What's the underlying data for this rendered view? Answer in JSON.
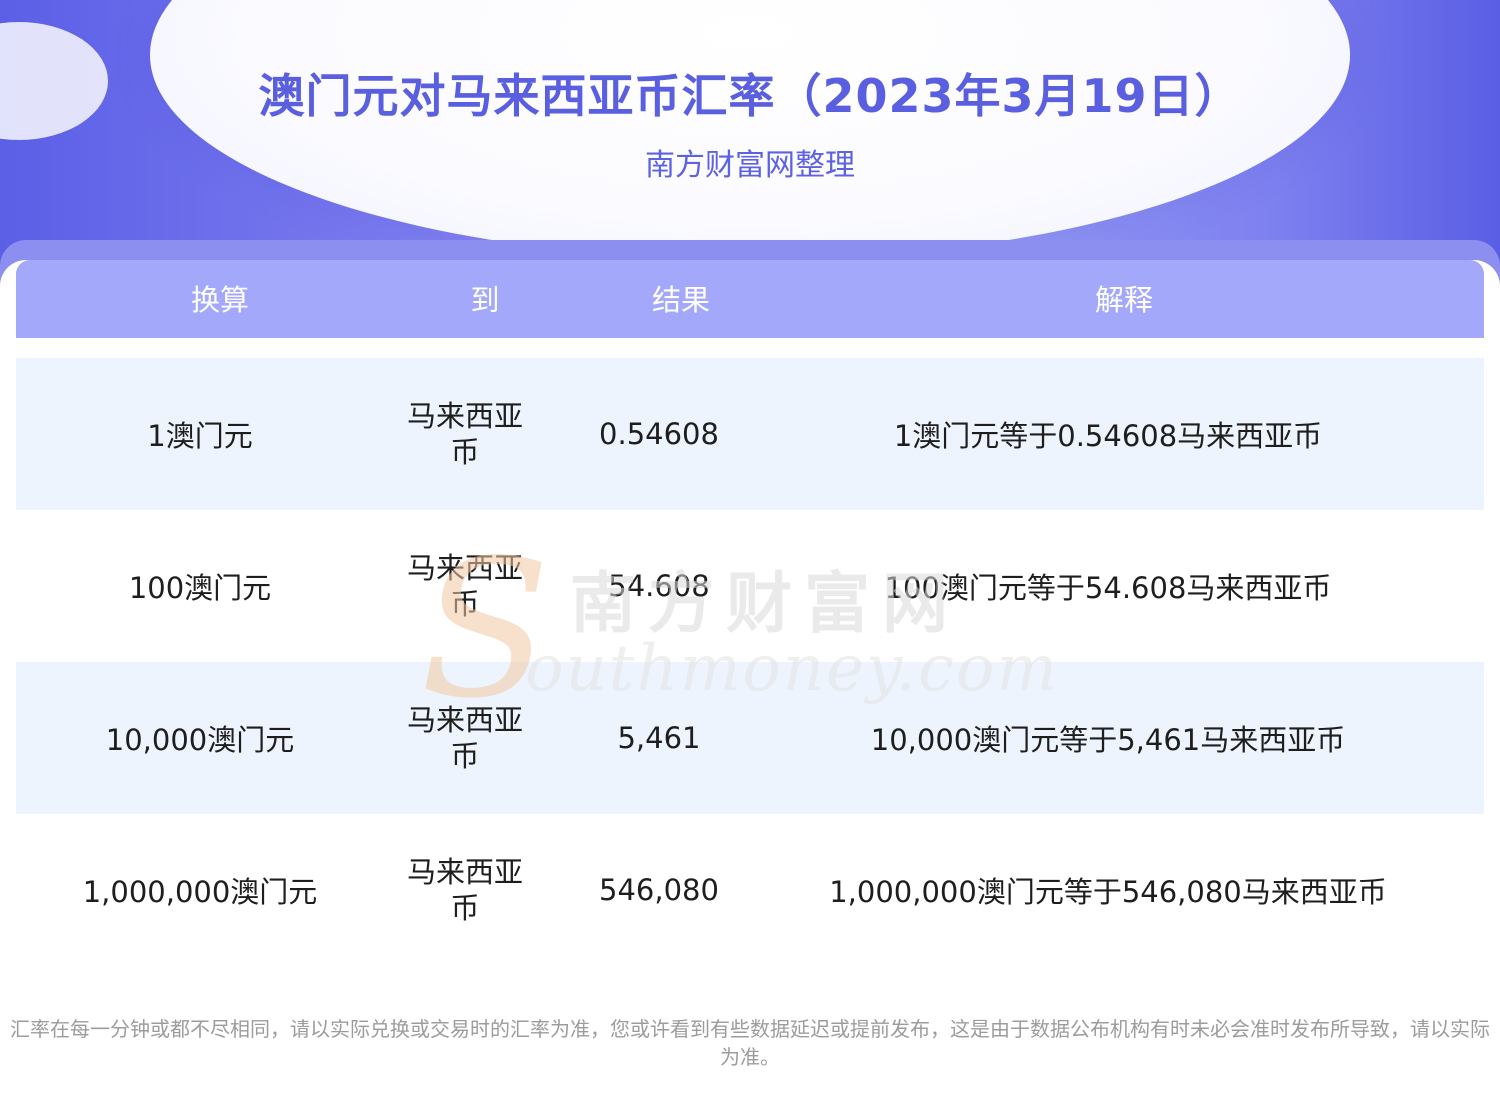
{
  "header": {
    "title": "澳门元对马来西亚币汇率（2023年3月19日）",
    "subtitle": "南方财富网整理"
  },
  "table": {
    "columns": [
      "换算",
      "到",
      "结果",
      "解释"
    ],
    "rows": [
      {
        "amount": "1澳门元",
        "to": "马来西亚币",
        "result": "0.54608",
        "explain": "1澳门元等于0.54608马来西亚币"
      },
      {
        "amount": "100澳门元",
        "to": "马来西亚币",
        "result": "54.608",
        "explain": "100澳门元等于54.608马来西亚币"
      },
      {
        "amount": "10,000澳门元",
        "to": "马来西亚币",
        "result": "5,461",
        "explain": "10,000澳门元等于5,461马来西亚币"
      },
      {
        "amount": "1,000,000澳门元",
        "to": "马来西亚币",
        "result": "546,080",
        "explain": "1,000,000澳门元等于546,080马来西亚币"
      }
    ]
  },
  "watermark": {
    "cn": "南方财富网",
    "en": "outhmoney.com",
    "letter": "S"
  },
  "footer": {
    "note": "汇率在每一分钟或都不尽相同，请以实际兑换或交易时的汇率为准，您或许看到有些数据延迟或提前发布，这是由于数据公布机构有时未必会准时发布所导致，请以实际为准。"
  },
  "colors": {
    "accent": "#5a5fe0",
    "table_header": "#a3a8fb",
    "row_shade": "#eef4fd"
  }
}
